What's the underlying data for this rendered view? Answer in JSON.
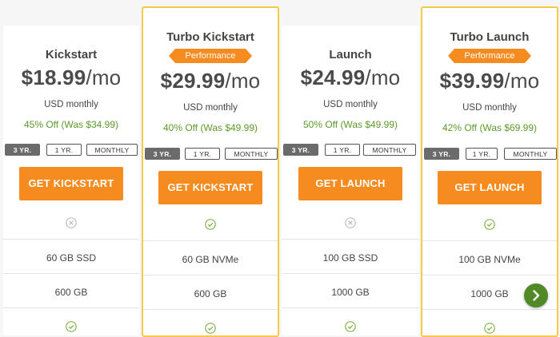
{
  "plans": [
    {
      "name": "Kickstart",
      "badge": "",
      "price_amount": "$18.99",
      "price_period": "/mo",
      "billing": "USD monthly",
      "discount": "45% Off (Was $34.99)",
      "terms": [
        "3 YR.",
        "1 YR.",
        "MONTHLY"
      ],
      "selected_term": "3 YR.",
      "cta": "GET KICKSTART",
      "feature_icon_1": "x-circle-icon",
      "storage": "60 GB SSD",
      "bandwidth": "600 GB",
      "feature_icon_2": "check-circle-icon"
    },
    {
      "name": "Turbo Kickstart",
      "badge": "Performance",
      "price_amount": "$29.99",
      "price_period": "/mo",
      "billing": "USD monthly",
      "discount": "40% Off (Was $49.99)",
      "terms": [
        "3 YR.",
        "1 YR.",
        "MONTHLY"
      ],
      "selected_term": "3 YR.",
      "cta": "GET KICKSTART",
      "feature_icon_1": "check-circle-icon",
      "storage": "60 GB NVMe",
      "bandwidth": "600 GB",
      "feature_icon_2": "check-circle-icon"
    },
    {
      "name": "Launch",
      "badge": "",
      "price_amount": "$24.99",
      "price_period": "/mo",
      "billing": "USD monthly",
      "discount": "50% Off (Was $49.99)",
      "terms": [
        "3 YR.",
        "1 YR.",
        "MONTHLY"
      ],
      "selected_term": "3 YR.",
      "cta": "GET LAUNCH",
      "feature_icon_1": "x-circle-icon",
      "storage": "100 GB SSD",
      "bandwidth": "1000 GB",
      "feature_icon_2": "check-circle-icon"
    },
    {
      "name": "Turbo Launch",
      "badge": "Performance",
      "price_amount": "$39.99",
      "price_period": "/mo",
      "billing": "USD monthly",
      "discount": "42% Off (Was $69.99)",
      "terms": [
        "3 YR.",
        "1 YR.",
        "MONTHLY"
      ],
      "selected_term": "3 YR.",
      "cta": "GET LAUNCH",
      "feature_icon_1": "check-circle-icon",
      "storage": "100 GB NVMe",
      "bandwidth": "1000 GB",
      "feature_icon_2": "check-circle-icon"
    }
  ],
  "scroll_button_icon": "chevron-right-icon",
  "colors": {
    "accent_orange": "#f68b1f",
    "featured_border": "#f7c948",
    "discount_green": "#5c9a2c",
    "check_green": "#7fb24a",
    "x_gray": "#bdbdbd",
    "active_term_bg": "#6b6b6b",
    "scroll_button_bg": "#4f8a26"
  }
}
